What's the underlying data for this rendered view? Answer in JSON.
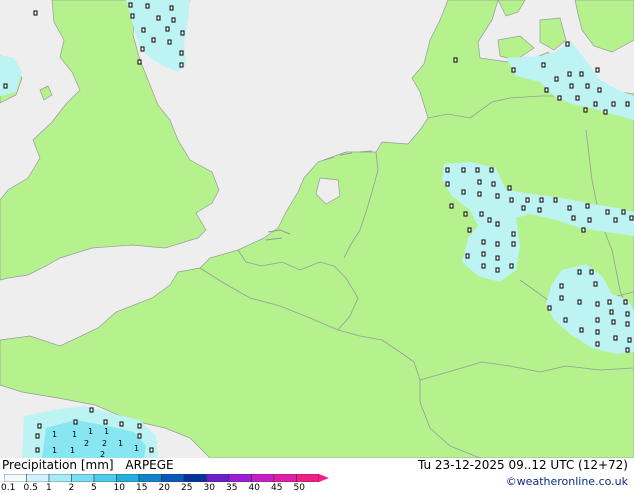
{
  "header": {
    "left_label": "Precipitation [mm]",
    "model": "ARPEGE",
    "valid_time": "Tu 23-12-2025 09..12 UTC (12+72)"
  },
  "credit": "©weatheronline.co.uk",
  "colors": {
    "sea": "#eeeeee",
    "land": "#b5f18c",
    "border": "#9a9a9a",
    "light_precip": "#bdf3f3",
    "medium_precip": "#88e6f2",
    "dot": "#000000"
  },
  "legend": {
    "tick_labels": [
      "0.1",
      "0.5",
      "1",
      "2",
      "5",
      "10",
      "15",
      "20",
      "25",
      "30",
      "35",
      "40",
      "45",
      "50"
    ],
    "colors": [
      "#f0fbff",
      "#cff4ff",
      "#a4ecf8",
      "#77def3",
      "#4ccbec",
      "#23b0e0",
      "#1182cc",
      "#0a58b8",
      "#06339a",
      "#6c1ec8",
      "#9e1ed8",
      "#c81ec6",
      "#e01ea9",
      "#f01e88"
    ]
  },
  "cell_values": [
    "1",
    "1",
    "1",
    "1",
    "2",
    "1",
    "2",
    "1",
    "1",
    "2",
    "1"
  ]
}
